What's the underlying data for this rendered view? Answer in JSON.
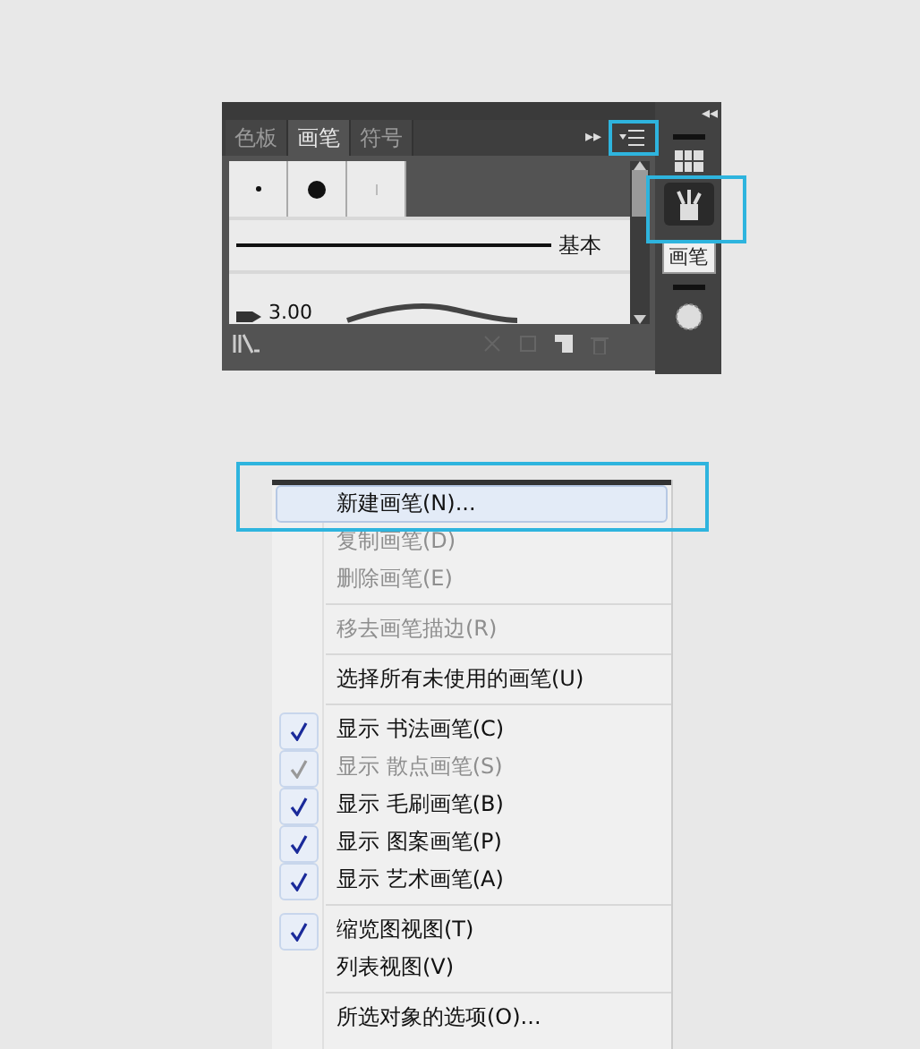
{
  "panel": {
    "tabs": [
      {
        "label": "色板",
        "selected": false
      },
      {
        "label": "画笔",
        "selected": true
      },
      {
        "label": "符号",
        "selected": false
      }
    ],
    "expand_glyph": "▸▸",
    "collapse_glyph": "◂◂",
    "brush_row": {
      "name": "基本"
    },
    "brush_partial": {
      "size": "3.00"
    },
    "tooltip": "画笔"
  },
  "menu": {
    "groups": [
      [
        {
          "label": "新建画笔(N)...",
          "disabled": false,
          "highlighted": true
        },
        {
          "label": "复制画笔(D)",
          "disabled": true,
          "highlighted": false
        },
        {
          "label": "删除画笔(E)",
          "disabled": true,
          "highlighted": false
        }
      ],
      [
        {
          "label": "移去画笔描边(R)",
          "disabled": true,
          "highlighted": false
        }
      ],
      [
        {
          "label": "选择所有未使用的画笔(U)",
          "disabled": false,
          "highlighted": false
        }
      ],
      [
        {
          "label": "显示 书法画笔(C)",
          "disabled": false,
          "checked": true,
          "highlighted": false
        },
        {
          "label": "显示 散点画笔(S)",
          "disabled": true,
          "checked": true,
          "highlighted": false
        },
        {
          "label": "显示 毛刷画笔(B)",
          "disabled": false,
          "checked": true,
          "highlighted": false
        },
        {
          "label": "显示 图案画笔(P)",
          "disabled": false,
          "checked": true,
          "highlighted": false
        },
        {
          "label": "显示 艺术画笔(A)",
          "disabled": false,
          "checked": true,
          "highlighted": false
        }
      ],
      [
        {
          "label": "缩览图视图(T)",
          "disabled": false,
          "checked": true,
          "highlighted": false
        },
        {
          "label": "列表视图(V)",
          "disabled": false,
          "checked": false,
          "highlighted": false
        }
      ],
      [
        {
          "label": "所选对象的选项(O)...",
          "highlighted": false
        }
      ]
    ]
  }
}
